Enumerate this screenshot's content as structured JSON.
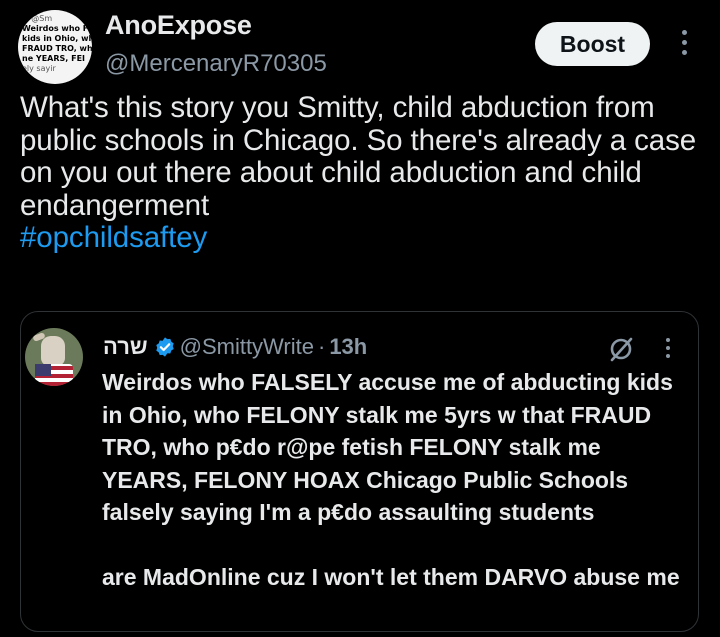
{
  "post": {
    "avatar_text": [
      "@Sm",
      "Weirdos who F",
      "kids in Ohio, wh",
      "FRAUD TRO, wh",
      "ne YEARS, FEI",
      "ely sayir"
    ],
    "author_name": "AnoExpose",
    "author_handle": "@MercenaryR70305",
    "boost_label": "Boost",
    "text": "What's this story you Smitty, child abduction from public schools in Chicago. So there's already a case on you out there about child abduction and child endangerment",
    "hashtag": "#opchildsaftey"
  },
  "quote": {
    "author_name": "שרה",
    "author_handle": "@SmittyWrite",
    "separator": "·",
    "time": "13h",
    "paragraph1": "Weirdos who FALSELY accuse me of abducting kids in Ohio, who FELONY stalk me 5yrs w that FRAUD TRO, who p€do r@pe fetish FELONY stalk me YEARS, FELONY HOAX Chicago Public Schools falsely saying I'm a p€do assaulting students",
    "paragraph2": "are MadOnline cuz I won't let them DARVO abuse me"
  },
  "colors": {
    "background": "#000000",
    "text": "#e7e9ea",
    "secondary": "#8b98a5",
    "link": "#1d9bf0",
    "verified": "#1d9bf0",
    "boost_bg": "#eff3f4",
    "border": "#2f3336"
  },
  "icons": [
    "verified-badge-icon",
    "grok-icon",
    "more-options-icon"
  ]
}
